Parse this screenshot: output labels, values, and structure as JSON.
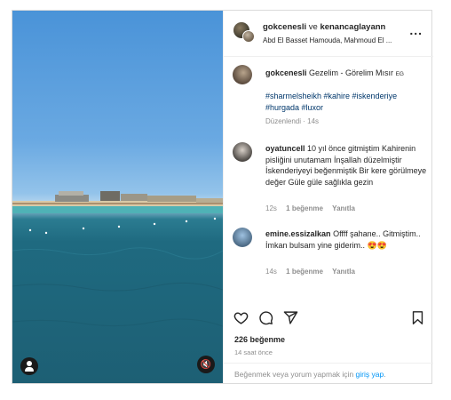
{
  "header": {
    "user1": "gokcenesli",
    "conjunction": "ve",
    "user2": "kenancaglayann",
    "subtitle": "Abd El Basset Hamouda, Mahmoud El ...",
    "more_label": "..."
  },
  "caption": {
    "username": "gokcenesli",
    "text": "Gezelim - Görelim Mısır",
    "flag": "EG",
    "hashtags": "#sharmelsheikh #kahire #iskenderiye #hurgada #luxor",
    "edited": "Düzenlendi · 14s"
  },
  "comments": [
    {
      "username": "oyatuncell",
      "text": "10 yıl önce gitmiştim Kahirenin pisliğini unutamam İnşallah düzelmiştir İskenderiyeyi beğenmiştik Bir kere görülmeye değer Güle güle sağlıkla gezin",
      "time": "12s",
      "likes": "1 beğenme",
      "reply": "Yanıtla"
    },
    {
      "username": "emine.essizalkan",
      "text": "Offff şahane.. Gitmiştim.. İmkan bulsam yine giderim.. 😍😍",
      "time": "14s",
      "likes": "1 beğenme",
      "reply": "Yanıtla"
    }
  ],
  "stats": {
    "likes": "226 beğenme",
    "time_ago": "14 saat önce"
  },
  "footer": {
    "prefix": "Beğenmek veya yorum yapmak için",
    "link": "giriş yap",
    "suffix": "."
  },
  "icons": [
    "heart-icon",
    "comment-icon",
    "share-icon",
    "bookmark-icon",
    "user-tag-icon",
    "mute-icon"
  ]
}
